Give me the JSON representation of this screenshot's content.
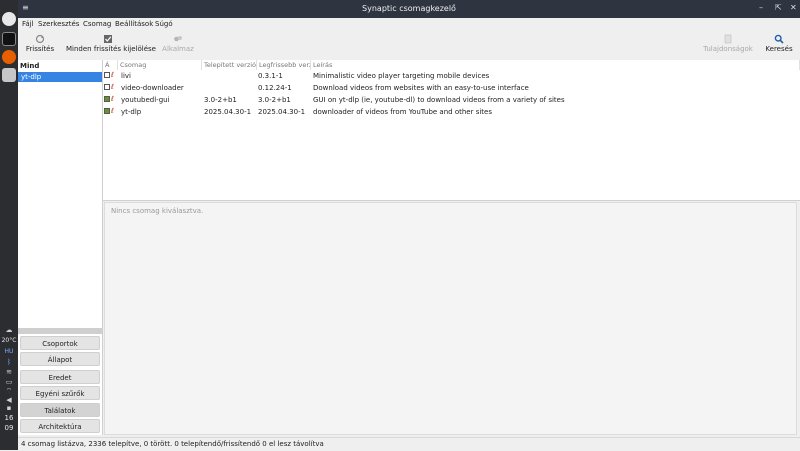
{
  "window": {
    "title": "Synaptic csomagkezelő"
  },
  "menubar": [
    "Fájl",
    "Szerkesztés",
    "Csomag",
    "Beállítások",
    "Súgó"
  ],
  "toolbar": {
    "refresh": "Frissítés",
    "mark_all": "Minden frissítés kijelölése",
    "apply": "Alkalmaz",
    "properties": "Tulajdonságok",
    "search": "Keresés"
  },
  "sidebar": {
    "header": "Mind",
    "items": [
      "yt-dlp"
    ],
    "filters": [
      "Csoportok",
      "Állapot",
      "Eredet",
      "Egyéni szűrők",
      "Találatok",
      "Architektúra"
    ],
    "active_filter": "Találatok"
  },
  "table": {
    "columns": [
      "Á",
      "Csomag",
      "Telepített verzió",
      "Legfrissebb verzió",
      "Leírás"
    ],
    "rows": [
      {
        "installed": false,
        "name": "livi",
        "installed_version": "",
        "latest_version": "0.3.1-1",
        "description": "Minimalistic video player targeting mobile devices"
      },
      {
        "installed": false,
        "name": "video-downloader",
        "installed_version": "",
        "latest_version": "0.12.24-1",
        "description": "Download videos from websites with an easy-to-use interface"
      },
      {
        "installed": true,
        "name": "youtubedl-gui",
        "installed_version": "3.0-2+b1",
        "latest_version": "3.0-2+b1",
        "description": "GUI on yt-dlp (ie, youtube-dl) to download videos from a variety of sites"
      },
      {
        "installed": true,
        "name": "yt-dlp",
        "installed_version": "2025.04.30-1",
        "latest_version": "2025.04.30-1",
        "description": "downloader of videos from YouTube and other sites"
      }
    ]
  },
  "details": {
    "placeholder": "Nincs csomag kiválasztva."
  },
  "statusbar": {
    "text": "4 csomag listázva, 2336 telepítve, 0 törött. 0 telepítendő/frissítendő 0 el lesz távolítva"
  },
  "taskbar": {
    "weather": "20°C",
    "lang": "HU",
    "clock_hour": "16",
    "clock_min": "09"
  },
  "colors": {
    "selection": "#3584e4",
    "titlebar": "#2e3440",
    "installed": "#6b8a4b"
  }
}
